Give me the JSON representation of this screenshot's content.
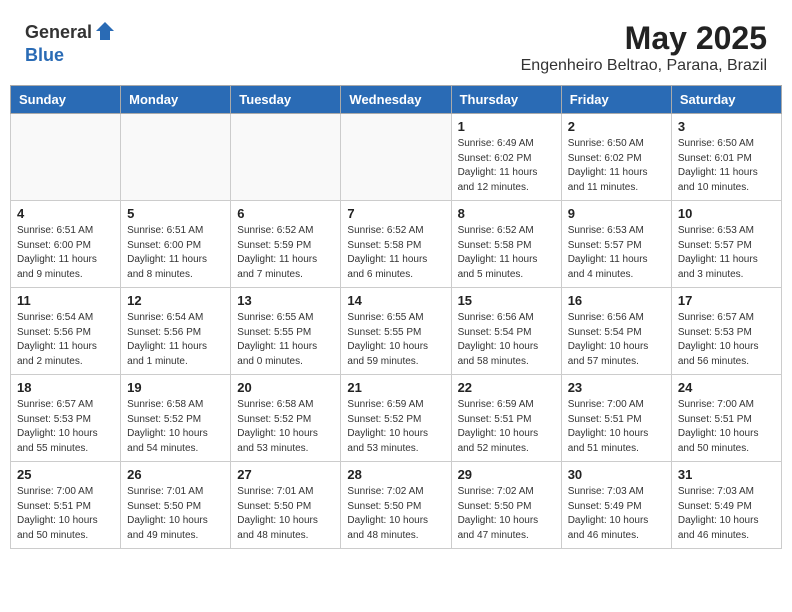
{
  "header": {
    "logo_line1": "General",
    "logo_line2": "Blue",
    "title": "May 2025",
    "subtitle": "Engenheiro Beltrao, Parana, Brazil"
  },
  "weekdays": [
    "Sunday",
    "Monday",
    "Tuesday",
    "Wednesday",
    "Thursday",
    "Friday",
    "Saturday"
  ],
  "weeks": [
    [
      {
        "day": "",
        "info": ""
      },
      {
        "day": "",
        "info": ""
      },
      {
        "day": "",
        "info": ""
      },
      {
        "day": "",
        "info": ""
      },
      {
        "day": "1",
        "info": "Sunrise: 6:49 AM\nSunset: 6:02 PM\nDaylight: 11 hours\nand 12 minutes."
      },
      {
        "day": "2",
        "info": "Sunrise: 6:50 AM\nSunset: 6:02 PM\nDaylight: 11 hours\nand 11 minutes."
      },
      {
        "day": "3",
        "info": "Sunrise: 6:50 AM\nSunset: 6:01 PM\nDaylight: 11 hours\nand 10 minutes."
      }
    ],
    [
      {
        "day": "4",
        "info": "Sunrise: 6:51 AM\nSunset: 6:00 PM\nDaylight: 11 hours\nand 9 minutes."
      },
      {
        "day": "5",
        "info": "Sunrise: 6:51 AM\nSunset: 6:00 PM\nDaylight: 11 hours\nand 8 minutes."
      },
      {
        "day": "6",
        "info": "Sunrise: 6:52 AM\nSunset: 5:59 PM\nDaylight: 11 hours\nand 7 minutes."
      },
      {
        "day": "7",
        "info": "Sunrise: 6:52 AM\nSunset: 5:58 PM\nDaylight: 11 hours\nand 6 minutes."
      },
      {
        "day": "8",
        "info": "Sunrise: 6:52 AM\nSunset: 5:58 PM\nDaylight: 11 hours\nand 5 minutes."
      },
      {
        "day": "9",
        "info": "Sunrise: 6:53 AM\nSunset: 5:57 PM\nDaylight: 11 hours\nand 4 minutes."
      },
      {
        "day": "10",
        "info": "Sunrise: 6:53 AM\nSunset: 5:57 PM\nDaylight: 11 hours\nand 3 minutes."
      }
    ],
    [
      {
        "day": "11",
        "info": "Sunrise: 6:54 AM\nSunset: 5:56 PM\nDaylight: 11 hours\nand 2 minutes."
      },
      {
        "day": "12",
        "info": "Sunrise: 6:54 AM\nSunset: 5:56 PM\nDaylight: 11 hours\nand 1 minute."
      },
      {
        "day": "13",
        "info": "Sunrise: 6:55 AM\nSunset: 5:55 PM\nDaylight: 11 hours\nand 0 minutes."
      },
      {
        "day": "14",
        "info": "Sunrise: 6:55 AM\nSunset: 5:55 PM\nDaylight: 10 hours\nand 59 minutes."
      },
      {
        "day": "15",
        "info": "Sunrise: 6:56 AM\nSunset: 5:54 PM\nDaylight: 10 hours\nand 58 minutes."
      },
      {
        "day": "16",
        "info": "Sunrise: 6:56 AM\nSunset: 5:54 PM\nDaylight: 10 hours\nand 57 minutes."
      },
      {
        "day": "17",
        "info": "Sunrise: 6:57 AM\nSunset: 5:53 PM\nDaylight: 10 hours\nand 56 minutes."
      }
    ],
    [
      {
        "day": "18",
        "info": "Sunrise: 6:57 AM\nSunset: 5:53 PM\nDaylight: 10 hours\nand 55 minutes."
      },
      {
        "day": "19",
        "info": "Sunrise: 6:58 AM\nSunset: 5:52 PM\nDaylight: 10 hours\nand 54 minutes."
      },
      {
        "day": "20",
        "info": "Sunrise: 6:58 AM\nSunset: 5:52 PM\nDaylight: 10 hours\nand 53 minutes."
      },
      {
        "day": "21",
        "info": "Sunrise: 6:59 AM\nSunset: 5:52 PM\nDaylight: 10 hours\nand 53 minutes."
      },
      {
        "day": "22",
        "info": "Sunrise: 6:59 AM\nSunset: 5:51 PM\nDaylight: 10 hours\nand 52 minutes."
      },
      {
        "day": "23",
        "info": "Sunrise: 7:00 AM\nSunset: 5:51 PM\nDaylight: 10 hours\nand 51 minutes."
      },
      {
        "day": "24",
        "info": "Sunrise: 7:00 AM\nSunset: 5:51 PM\nDaylight: 10 hours\nand 50 minutes."
      }
    ],
    [
      {
        "day": "25",
        "info": "Sunrise: 7:00 AM\nSunset: 5:51 PM\nDaylight: 10 hours\nand 50 minutes."
      },
      {
        "day": "26",
        "info": "Sunrise: 7:01 AM\nSunset: 5:50 PM\nDaylight: 10 hours\nand 49 minutes."
      },
      {
        "day": "27",
        "info": "Sunrise: 7:01 AM\nSunset: 5:50 PM\nDaylight: 10 hours\nand 48 minutes."
      },
      {
        "day": "28",
        "info": "Sunrise: 7:02 AM\nSunset: 5:50 PM\nDaylight: 10 hours\nand 48 minutes."
      },
      {
        "day": "29",
        "info": "Sunrise: 7:02 AM\nSunset: 5:50 PM\nDaylight: 10 hours\nand 47 minutes."
      },
      {
        "day": "30",
        "info": "Sunrise: 7:03 AM\nSunset: 5:49 PM\nDaylight: 10 hours\nand 46 minutes."
      },
      {
        "day": "31",
        "info": "Sunrise: 7:03 AM\nSunset: 5:49 PM\nDaylight: 10 hours\nand 46 minutes."
      }
    ]
  ]
}
